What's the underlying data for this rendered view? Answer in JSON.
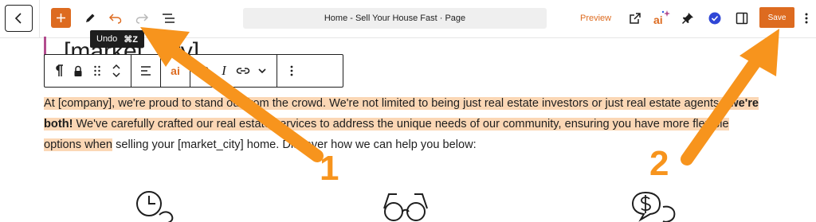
{
  "toolbar": {
    "tooltip_label": "Undo",
    "tooltip_shortcut": "⌘Z",
    "document_title": "Home - Sell Your House Fast · Page",
    "preview_label": "Preview",
    "save_label": "Save",
    "ai_label": "ai",
    "accent_color": "#dd6b20"
  },
  "canvas": {
    "heading_partial": "[market_city]",
    "paragraph": {
      "part1": "At [company], we're proud to stand out from the crowd. We're not limited to being just real estate investors or just real estate agents - ",
      "bold": "we're both!",
      "part2": " We've carefully crafted our real estate services to address the unique needs of our community, ensuring you have more flexible options when",
      "part3": " selling your [market_city] home. Discover how we can help you below:"
    },
    "block_toolbar": {
      "ai_label": "ai",
      "bold_label": "B",
      "italic_label": "I"
    }
  },
  "annotations": {
    "label_1": "1",
    "label_2": "2",
    "arrow_color": "#f7941d"
  }
}
